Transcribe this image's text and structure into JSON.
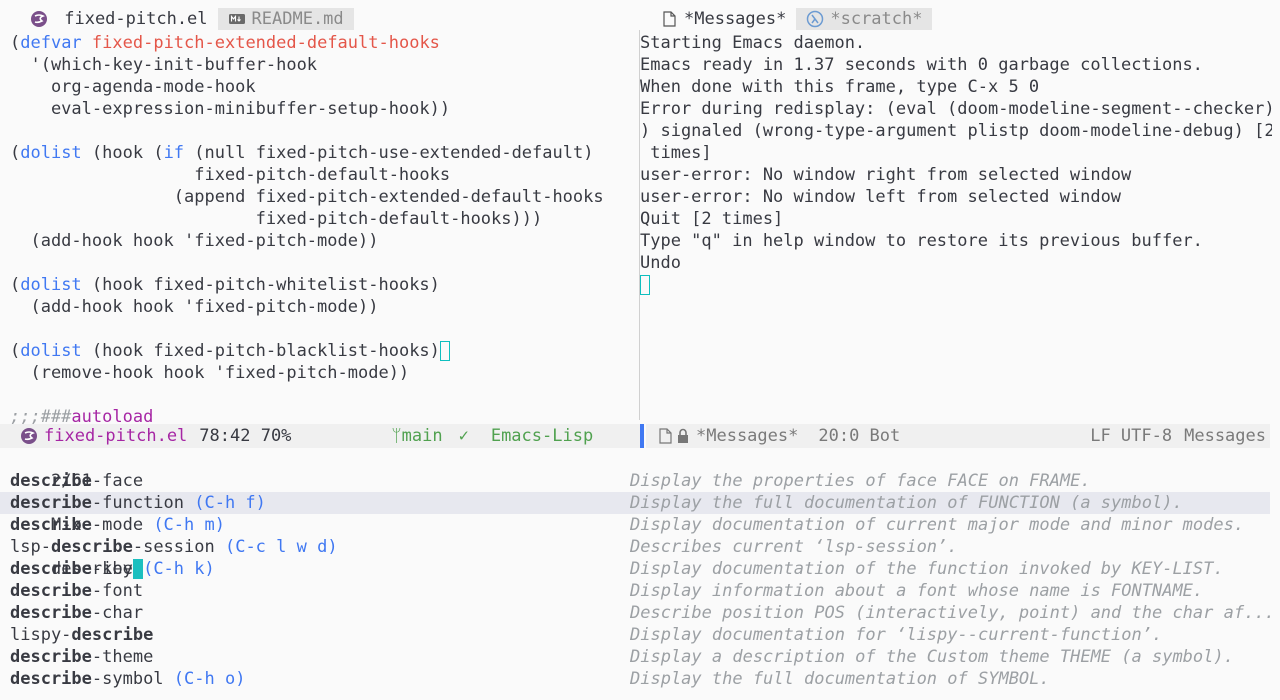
{
  "left_tabs": [
    {
      "label": " fixed-pitch.el",
      "icon": "emacs-icon",
      "active": true
    },
    {
      "label": "README.md",
      "icon": "markdown-icon",
      "active": false
    }
  ],
  "right_tabs": [
    {
      "label": "*Messages*",
      "icon": "file-icon",
      "active": true
    },
    {
      "label": "*scratch*",
      "icon": "lambda-icon",
      "active": false
    }
  ],
  "left_code": [
    {
      "segments": [
        {
          "t": "(",
          "c": ""
        },
        {
          "t": "defvar",
          "c": "kw"
        },
        {
          "t": " ",
          "c": ""
        },
        {
          "t": "fixed-pitch-extended-default-hooks",
          "c": "var"
        }
      ]
    },
    {
      "segments": [
        {
          "t": "  '(which-key-init-buffer-hook",
          "c": ""
        }
      ]
    },
    {
      "segments": [
        {
          "t": "    org-agenda-mode-hook",
          "c": ""
        }
      ]
    },
    {
      "segments": [
        {
          "t": "    eval-expression-minibuffer-setup-hook))",
          "c": ""
        }
      ]
    },
    {
      "segments": [
        {
          "t": "",
          "c": ""
        }
      ]
    },
    {
      "segments": [
        {
          "t": "(",
          "c": ""
        },
        {
          "t": "dolist",
          "c": "kw"
        },
        {
          "t": " (hook (",
          "c": ""
        },
        {
          "t": "if",
          "c": "kw"
        },
        {
          "t": " (null fixed-pitch-use-extended-default)",
          "c": ""
        }
      ]
    },
    {
      "segments": [
        {
          "t": "                  fixed-pitch-default-hooks",
          "c": ""
        }
      ]
    },
    {
      "segments": [
        {
          "t": "                (append fixed-pitch-extended-default-hooks",
          "c": ""
        }
      ]
    },
    {
      "segments": [
        {
          "t": "                        fixed-pitch-default-hooks)))",
          "c": ""
        }
      ]
    },
    {
      "segments": [
        {
          "t": "  (add-hook hook 'fixed-pitch-mode))",
          "c": ""
        }
      ]
    },
    {
      "segments": [
        {
          "t": "",
          "c": ""
        }
      ]
    },
    {
      "segments": [
        {
          "t": "(",
          "c": ""
        },
        {
          "t": "dolist",
          "c": "kw"
        },
        {
          "t": " (hook fixed-pitch-whitelist-hooks)",
          "c": ""
        }
      ]
    },
    {
      "segments": [
        {
          "t": "  (add-hook hook 'fixed-pitch-mode))",
          "c": ""
        }
      ]
    },
    {
      "segments": [
        {
          "t": "",
          "c": ""
        }
      ]
    },
    {
      "segments": [
        {
          "t": "(",
          "c": ""
        },
        {
          "t": "dolist",
          "c": "kw"
        },
        {
          "t": " (hook fixed-pitch-blacklist-hooks)",
          "c": ""
        }
      ],
      "cursor": true
    },
    {
      "segments": [
        {
          "t": "  (remove-hook hook 'fixed-pitch-mode))",
          "c": ""
        }
      ]
    },
    {
      "segments": [
        {
          "t": "",
          "c": ""
        }
      ]
    },
    {
      "segments": [
        {
          "t": ";;;###",
          "c": "comment"
        },
        {
          "t": "autoload",
          "c": "def"
        }
      ]
    }
  ],
  "right_lines": [
    "Starting Emacs daemon.",
    "Emacs ready in 1.37 seconds with 0 garbage collections.",
    "When done with this frame, type C-x 5 0",
    "Error during redisplay: (eval (doom-modeline-segment--checker)\\",
    ") signaled (wrong-type-argument plistp doom-modeline-debug) [2\\",
    " times]",
    "user-error: No window right from selected window",
    "user-error: No window left from selected window",
    "Quit [2 times]",
    "Type \"q\" in help window to restore its previous buffer.",
    "Undo"
  ],
  "modeline_left": {
    "buffer": "fixed-pitch.el",
    "position": "78:42 70%",
    "branch": "main",
    "checker": "✓",
    "mode": "Emacs-Lisp"
  },
  "modeline_right": {
    "buffer": "*Messages*",
    "position": "20:0 Bot",
    "encoding": "LF UTF-8",
    "mode": "Messages"
  },
  "minibuffer": {
    "count": "2/61",
    "prompt": "M-x",
    "input": "describe"
  },
  "candidates": [
    {
      "pre": "",
      "match": "describe",
      "post": "-face",
      "key": "",
      "doc": "Display the properties of face FACE on FRAME."
    },
    {
      "pre": "",
      "match": "describe",
      "post": "-function",
      "key": " (C-h f)",
      "doc": "Display the full documentation of FUNCTION (a symbol).",
      "selected": true
    },
    {
      "pre": "",
      "match": "describe",
      "post": "-mode",
      "key": " (C-h m)",
      "doc": "Display documentation of current major mode and minor modes."
    },
    {
      "pre": "lsp-",
      "match": "describe",
      "post": "-session",
      "key": " (C-c l w d)",
      "doc": "Describes current ‘lsp-session’."
    },
    {
      "pre": "",
      "match": "describe",
      "post": "-key",
      "key": " (C-h k)",
      "doc": "Display documentation of the function invoked by KEY-LIST."
    },
    {
      "pre": "",
      "match": "describe",
      "post": "-font",
      "key": "",
      "doc": "Display information about a font whose name is FONTNAME."
    },
    {
      "pre": "",
      "match": "describe",
      "post": "-char",
      "key": "",
      "doc": "Describe position POS (interactively, point) and the char af..."
    },
    {
      "pre": "lispy-",
      "match": "describe",
      "post": "",
      "key": "",
      "doc": "Display documentation for ‘lispy--current-function’."
    },
    {
      "pre": "",
      "match": "describe",
      "post": "-theme",
      "key": "",
      "doc": "Display a description of the Custom theme THEME (a symbol)."
    },
    {
      "pre": "",
      "match": "describe",
      "post": "-symbol",
      "key": " (C-h o)",
      "doc": "Display the full documentation of SYMBOL."
    }
  ]
}
